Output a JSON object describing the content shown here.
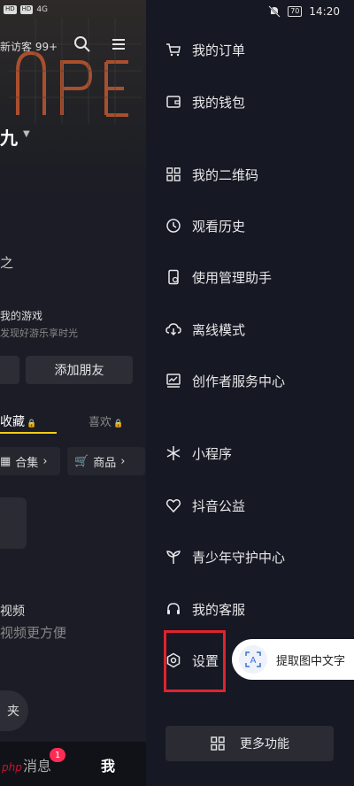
{
  "left_panel": {
    "status_left_pills": [
      "HD",
      "HD"
    ],
    "status_left_signal": "4G",
    "visitor_label": "新访客 99+",
    "name_fragment": "九",
    "stat_fragment": "之",
    "game": {
      "title": "我的游戏",
      "subtitle": "发现好游乐享时光"
    },
    "add_friend_button": "添加朋友",
    "tabs": {
      "favorites": "收藏",
      "likes": "喜欢"
    },
    "chips": {
      "collection": "合集",
      "goods": "商品"
    },
    "empty_state": {
      "title": "视频",
      "subtitle": "视频更方便"
    },
    "bottom_button_fragment": "夹",
    "bottom_nav": {
      "messages": "消息",
      "me": "我",
      "badge_count": "1"
    },
    "watermark": "php"
  },
  "status_right": {
    "battery": "70",
    "time": "14:20"
  },
  "drawer": {
    "menu": [
      {
        "label": "我的订单",
        "icon": "cart-icon"
      },
      {
        "label": "我的钱包",
        "icon": "wallet-icon"
      },
      {
        "label": "我的二维码",
        "icon": "qrcode-icon"
      },
      {
        "label": "观看历史",
        "icon": "clock-icon"
      },
      {
        "label": "使用管理助手",
        "icon": "phone-manage-icon"
      },
      {
        "label": "离线模式",
        "icon": "cloud-download-icon"
      },
      {
        "label": "创作者服务中心",
        "icon": "creator-chart-icon"
      },
      {
        "label": "小程序",
        "icon": "asterisk-icon"
      },
      {
        "label": "抖音公益",
        "icon": "heart-hands-icon"
      },
      {
        "label": "青少年守护中心",
        "icon": "sprout-icon"
      },
      {
        "label": "我的客服",
        "icon": "headset-icon"
      },
      {
        "label": "设置",
        "icon": "gear-icon"
      }
    ],
    "more_button": "更多功能"
  },
  "ocr_button": {
    "label": "提取图中文字"
  },
  "colors": {
    "accent_red": "#e0232e",
    "tab_underline": "#facc15",
    "badge": "#fe2c55"
  }
}
